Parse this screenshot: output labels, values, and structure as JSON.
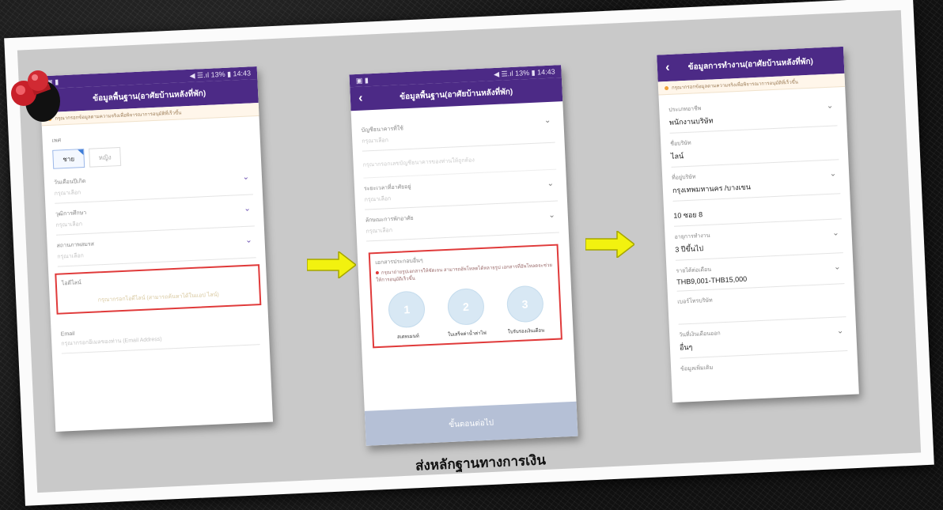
{
  "phone1": {
    "status_left": "▣ ▮",
    "status_right": "◀ ☰.ıl 13% ▮ 14:43",
    "title": "ข้อมูลพื้นฐาน(อาศัยบ้านหลังที่พัก)",
    "notice": "กรุณากรอกข้อมูลตามความจริงเพื่อพิจารณาการอนุมัติที่เร็วขึ้น",
    "gender_label": "เพศ",
    "male": "ชาย",
    "female": "หญิง",
    "birth_label": "วันเดือนปีเกิด",
    "birth_ph": "กรุณาเลือก",
    "education_label": "วุฒิการศึกษา",
    "education_ph": "กรุณาเลือก",
    "marital_label": "สถานภาพสมรส",
    "marital_ph": "กรุณาเลือก",
    "line_label": "ไอดีไลน์",
    "line_ph": "กรุณากรอกไอดีไลน์ (สามารถค้นหาได้ในแอป ไลน์)",
    "email_label": "Email",
    "email_ph": "กรุณากรอกอีเมลของท่าน (Email Address)"
  },
  "phone2": {
    "status_left": "▣ ▮",
    "status_right": "◀ ☰.ıl 13% ▮ 14:43",
    "title": "ข้อมูลพื้นฐาน(อาศัยบ้านหลังที่พัก)",
    "field1_label": "บัญชีธนาคารที่ใช้",
    "field1_ph": "กรุณาเลือก",
    "muted_row": "กรุณากรอกเลขบัญชีธนาคารของท่านให้ถูกต้อง",
    "field2_label": "ระยะเวลาที่อาศัยอยู่",
    "field2_ph": "กรุณาเลือก",
    "field3_label": "ลักษณะการพักอาศัย",
    "field3_ph": "กรุณาเลือก",
    "docs_title": "เอกสารประกอบอื่นๆ",
    "docs_note": "กรุณาถ่ายรูปเอกสารให้ชัดเจน สามารถอัพโหลดได้หลายรูป เอกสารที่อัพโหลดจะช่วยให้การอนุมัติเร็วขึ้น",
    "doc1": "สเตทเมนท์",
    "doc2": "ใบเสร็จค่าน้ำค่าไฟ",
    "doc3": "ใบรับรองเงินเดือน",
    "next_button": "ขั้นตอนต่อไป"
  },
  "phone3": {
    "title": "ข้อมูลการทำงาน(อาศัยบ้านหลังที่พัก)",
    "notice": "กรุณากรอกข้อมูลตามความจริงเพื่อพิจารณาการอนุมัติที่เร็วขึ้น",
    "job_label": "ประเภทอาชีพ",
    "job_value": "พนักงานบริษัท",
    "company_label": "ชื่อบริษัท",
    "company_value": "ไลน์",
    "address_label": "ที่อยู่บริษัท",
    "address_value": "กรุงเทพมหานคร /บางเขน",
    "address2_value": "10 ซอย 8",
    "years_label": "อายุการทำงาน",
    "years_value": "3 ปีขึ้นไป",
    "salary_label": "รายได้ต่อเดือน",
    "salary_value": "THB9,001-THB15,000",
    "phone_label": "เบอร์โทรบริษัท",
    "payday_label": "วันที่เงินเดือนออก",
    "payday_value": "อื่นๆ",
    "other_label": "ข้อมูลเพิ่มเติม"
  },
  "caption": "ส่งหลักฐานทางการเงิน"
}
